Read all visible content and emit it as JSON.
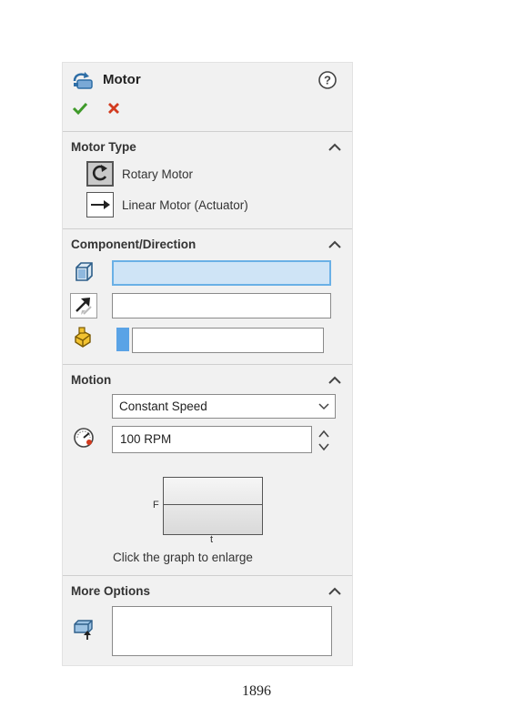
{
  "header": {
    "title": "Motor"
  },
  "motor_type": {
    "heading": "Motor Type",
    "options": [
      {
        "label": "Rotary Motor",
        "selected": true
      },
      {
        "label": "Linear Motor (Actuator)",
        "selected": false
      }
    ]
  },
  "component_direction": {
    "heading": "Component/Direction",
    "location_value": "",
    "direction_value": "",
    "relative_to_value": ""
  },
  "motion": {
    "heading": "Motion",
    "type_value": "Constant Speed",
    "speed_value": "100 RPM",
    "graph": {
      "y_axis_label": "F",
      "x_axis_label": "t"
    },
    "graph_caption": "Click the graph to enlarge"
  },
  "more_options": {
    "heading": "More Options",
    "load_bearing_faces_value": ""
  },
  "page_number": "1896",
  "colors": {
    "accept": "#3f9a2a",
    "cancel": "#d23b1f",
    "active_field": "#cfe4f6",
    "active_field_border": "#6ab0e6",
    "panel_background": "#f1f1f1"
  }
}
